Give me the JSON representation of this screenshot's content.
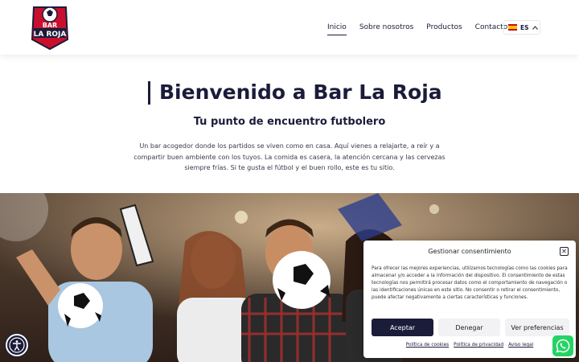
{
  "header": {
    "logo_text_top": "BAR",
    "logo_text_bottom": "LA ROJA",
    "nav": [
      {
        "label": "Inicio",
        "active": true
      },
      {
        "label": "Sobre nosotros",
        "active": false
      },
      {
        "label": "Productos",
        "active": false
      },
      {
        "label": "Contacto",
        "active": false
      }
    ],
    "language": "ES"
  },
  "hero": {
    "title": "Bienvenido a Bar La Roja",
    "subtitle": "Tu punto de encuentro futbolero",
    "intro": "Un bar acogedor donde los partidos se viven como en casa. Aquí vienes a relajarte, a reír y a compartir buen ambiente con los tuyos. La comida es casera, la atención cercana y las cervezas siempre frías. Si te gusta el fútbol y el buen rollo, este es tu sitio."
  },
  "cookie": {
    "title": "Gestionar consentimiento",
    "body": "Para ofrecer las mejores experiencias, utilizamos tecnologías como las cookies para almacenar y/o acceder a la información del dispositivo. El consentimiento de estas tecnologías nos permitirá procesar datos como el comportamiento de navegación o las identificaciones únicas en este sitio. No consentir o retirar el consentimiento, puede afectar negativamente a ciertas características y funciones.",
    "accept": "Aceptar",
    "deny": "Denegar",
    "prefs": "Ver preferencias",
    "links": [
      "Política de cookies",
      "Política de privacidad",
      "Aviso legal"
    ]
  },
  "colors": {
    "primary": "#1b1c3a",
    "whatsapp": "#25d366",
    "logo_red": "#c8102e"
  }
}
